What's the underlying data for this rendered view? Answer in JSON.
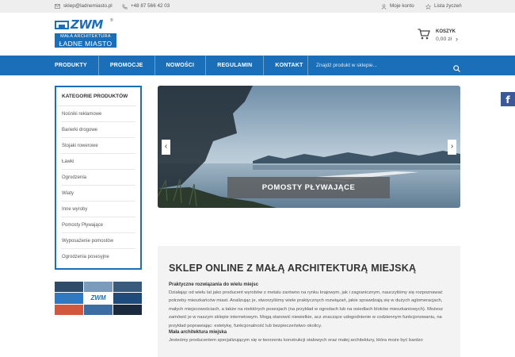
{
  "topbar": {
    "email": "sklep@ladnemiasto.pl",
    "phone": "+48 87 566 42 03",
    "account": "Moje konto",
    "wishlist": "Lista życzeń"
  },
  "logo": {
    "mark": "ZWM",
    "reg": "®",
    "line1": "MAŁA ARCHITEKTURA",
    "line2": "ŁADNE MIASTO"
  },
  "cart": {
    "label": "KOSZYK",
    "value": "0,00 zł"
  },
  "nav": {
    "links": [
      "PRODUKTY",
      "PROMOCJE",
      "NOWOŚCI",
      "REGULAMIN",
      "KONTAKT"
    ],
    "search_placeholder": "Znajdź produkt w sklepie..."
  },
  "sidebar": {
    "title": "KATEGORIE PRODUKTÓW",
    "items": [
      "Nośniki reklamowe",
      "Barierki drogowe",
      "Stojaki rowerowe",
      "Ławki",
      "Ogrodzenia",
      "Wiaty",
      "Inne wyroby",
      "Pomosty Pływające",
      "Wyposażenie pomostów",
      "Ogrodzenia posesyjne"
    ]
  },
  "promo": {
    "logo": "ZWM"
  },
  "slider": {
    "caption": "POMOSTY PŁYWAJĄCE",
    "prev": "‹",
    "next": "›"
  },
  "content": {
    "heading": "SKLEP ONLINE Z MAŁĄ ARCHITEKTURĄ MIEJSKĄ",
    "sub1": "Praktyczne rozwiązania do wielu miejsc",
    "para1": "Działając od wielu lat jako producent wyrobów z metalu zarówno na rynku krajowym, jak i zagranicznym, nauczyliśmy się rozpoznawać potrzeby mieszkańców miast. Analizując je, stworzyliśmy wiele praktycznych rozwiązań, jakie sprawdzają się w dużych aglomeracjach, małych miejscowościach, a także na niektórych posesjach (na przykład w ogrodach lub na osiedlach bloków mieszkaniowych). Możesz zamówić je w naszym sklepie internetowym. Mogą stanowić niewielkie, acz znaczące udogodnienie w codziennym funkcjonowaniu, na przykład poprawiając: estetykę, funkcjonalność lub bezpieczeństwo okolicy.",
    "sub2": "Mała architektura miejska",
    "para2": "Jesteśmy producentem specjalizującym się w tworzeniu konstrukcji stalowych oraz małej architektury, która może być bardzo"
  },
  "social": {
    "facebook": "f"
  },
  "colors": {
    "brand": "#1a6fb8",
    "topbar": "#eeeeee",
    "content_bg": "#f3f3f3",
    "facebook": "#3b5998"
  }
}
